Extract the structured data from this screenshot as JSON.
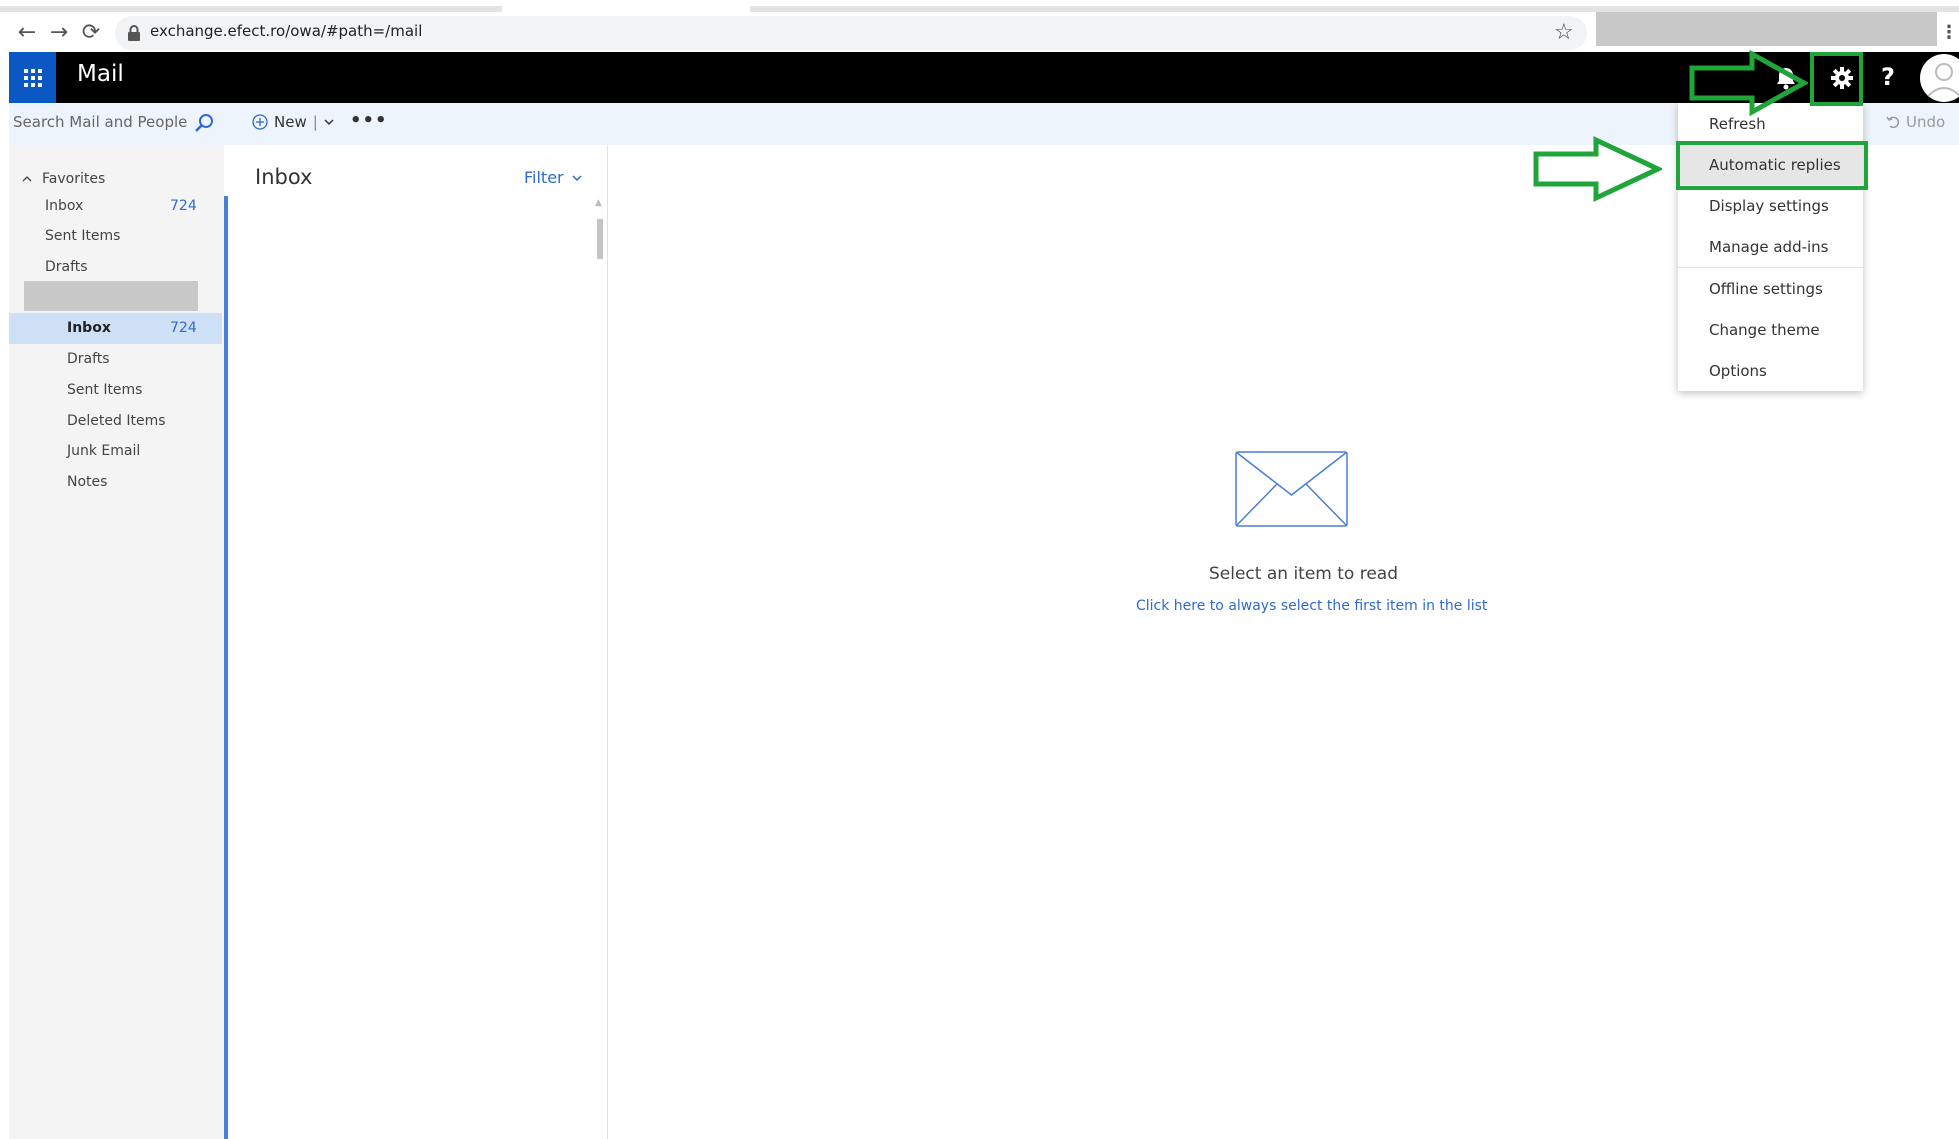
{
  "browser": {
    "url": "exchange.efect.ro/owa/#path=/mail",
    "back_glyph": "←",
    "forward_glyph": "→",
    "reload_glyph": "⟳",
    "star_glyph": "☆",
    "menu_glyph": "⋮"
  },
  "header": {
    "app_title": "Mail",
    "help_glyph": "?"
  },
  "toolbar": {
    "search_placeholder": "Search Mail and People",
    "new_label": "New",
    "new_separator": "|",
    "more_glyph": "•••",
    "undo_label": "Undo"
  },
  "nav": {
    "favorites_label": "Favorites",
    "favorites": [
      {
        "label": "Inbox",
        "count": "724"
      },
      {
        "label": "Sent Items",
        "count": ""
      },
      {
        "label": "Drafts",
        "count": ""
      }
    ],
    "folders": [
      {
        "label": "Inbox",
        "count": "724"
      },
      {
        "label": "Drafts",
        "count": ""
      },
      {
        "label": "Sent Items",
        "count": ""
      },
      {
        "label": "Deleted Items",
        "count": ""
      },
      {
        "label": "Junk Email",
        "count": ""
      },
      {
        "label": "Notes",
        "count": ""
      }
    ]
  },
  "list": {
    "title": "Inbox",
    "filter_label": "Filter"
  },
  "reading": {
    "empty_title": "Select an item to read",
    "empty_link": "Click here to always select the first item in the list"
  },
  "settings_menu": {
    "items": [
      {
        "label": "Refresh"
      },
      {
        "label": "Automatic replies"
      },
      {
        "label": "Display settings"
      },
      {
        "label": "Manage add-ins"
      },
      {
        "label": "Offline settings"
      },
      {
        "label": "Change theme"
      },
      {
        "label": "Options"
      }
    ]
  },
  "colors": {
    "accent": "#0b58c4",
    "annotation": "#1fa53a",
    "link": "#2f6bcc",
    "selection": "#cde0f5"
  }
}
